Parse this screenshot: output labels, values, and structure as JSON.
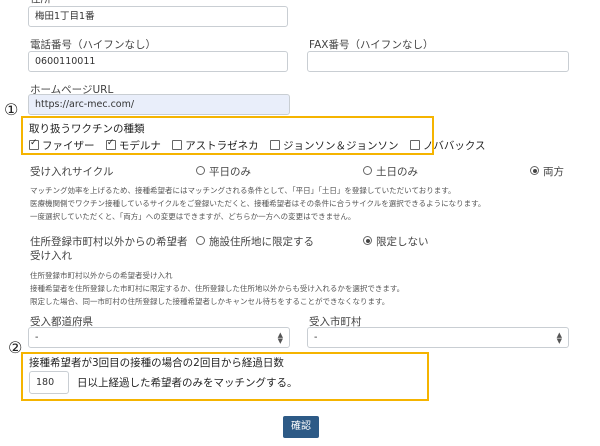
{
  "address": {
    "label": "住所",
    "value": "梅田1丁目1番"
  },
  "phone": {
    "label": "電話番号（ハイフンなし）",
    "value": "0600110011"
  },
  "fax": {
    "label": "FAX番号（ハイフンなし）",
    "value": ""
  },
  "homepage": {
    "label": "ホームページURL",
    "value": "https://arc-mec.com/"
  },
  "markers": {
    "one": "①",
    "two": "②"
  },
  "vaccines": {
    "label": "取り扱うワクチンの種類",
    "items": [
      {
        "label": "ファイザー",
        "checked": true
      },
      {
        "label": "モデルナ",
        "checked": true
      },
      {
        "label": "アストラゼネカ",
        "checked": false
      },
      {
        "label": "ジョンソン＆ジョンソン",
        "checked": false
      },
      {
        "label": "ノババックス",
        "checked": false
      }
    ]
  },
  "cycle": {
    "label": "受け入れサイクル",
    "options": [
      {
        "label": "平日のみ",
        "selected": false
      },
      {
        "label": "土日のみ",
        "selected": false
      },
      {
        "label": "両方",
        "selected": true
      }
    ],
    "help": [
      "マッチング効率を上げるため、接種希望者にはマッチングされる条件として、「平日」「土日」を登録していただいております。",
      "医療機関側でワクチン接種しているサイクルをご登録いただくと、接種希望者はその条件に合うサイクルを選択できるようになります。",
      "一度選択していただくと、「両方」への変更はできますが、どちらか一方への変更はできません。"
    ]
  },
  "residence": {
    "label_line1": "住所登録市町村以外からの希望者",
    "label_line2": "受け入れ",
    "options": [
      {
        "label": "施設住所地に限定する",
        "selected": false
      },
      {
        "label": "限定しない",
        "selected": true
      }
    ],
    "help": [
      "住所登録市町村以外からの希望者受け入れ",
      "接種希望者を住所登録した市町村に限定するか、住所登録した住所地以外からも受け入れるかを選択できます。",
      "限定した場合、同一市町村の住所登録した接種希望者しかキャンセル待ちをすることができなくなります。"
    ]
  },
  "prefecture": {
    "label": "受入都道府県",
    "value": "-"
  },
  "city": {
    "label": "受入市町村",
    "value": "-"
  },
  "interval": {
    "label": "接種希望者が3回目の接種の場合の2回目から経過日数",
    "value": "180",
    "suffix": "日以上経過した希望者のみをマッチングする。"
  },
  "confirm": {
    "label": "確認"
  },
  "colors": {
    "highlight": "#f5b400",
    "button": "#2d5a86",
    "url_field_bg": "#e9eefa"
  }
}
